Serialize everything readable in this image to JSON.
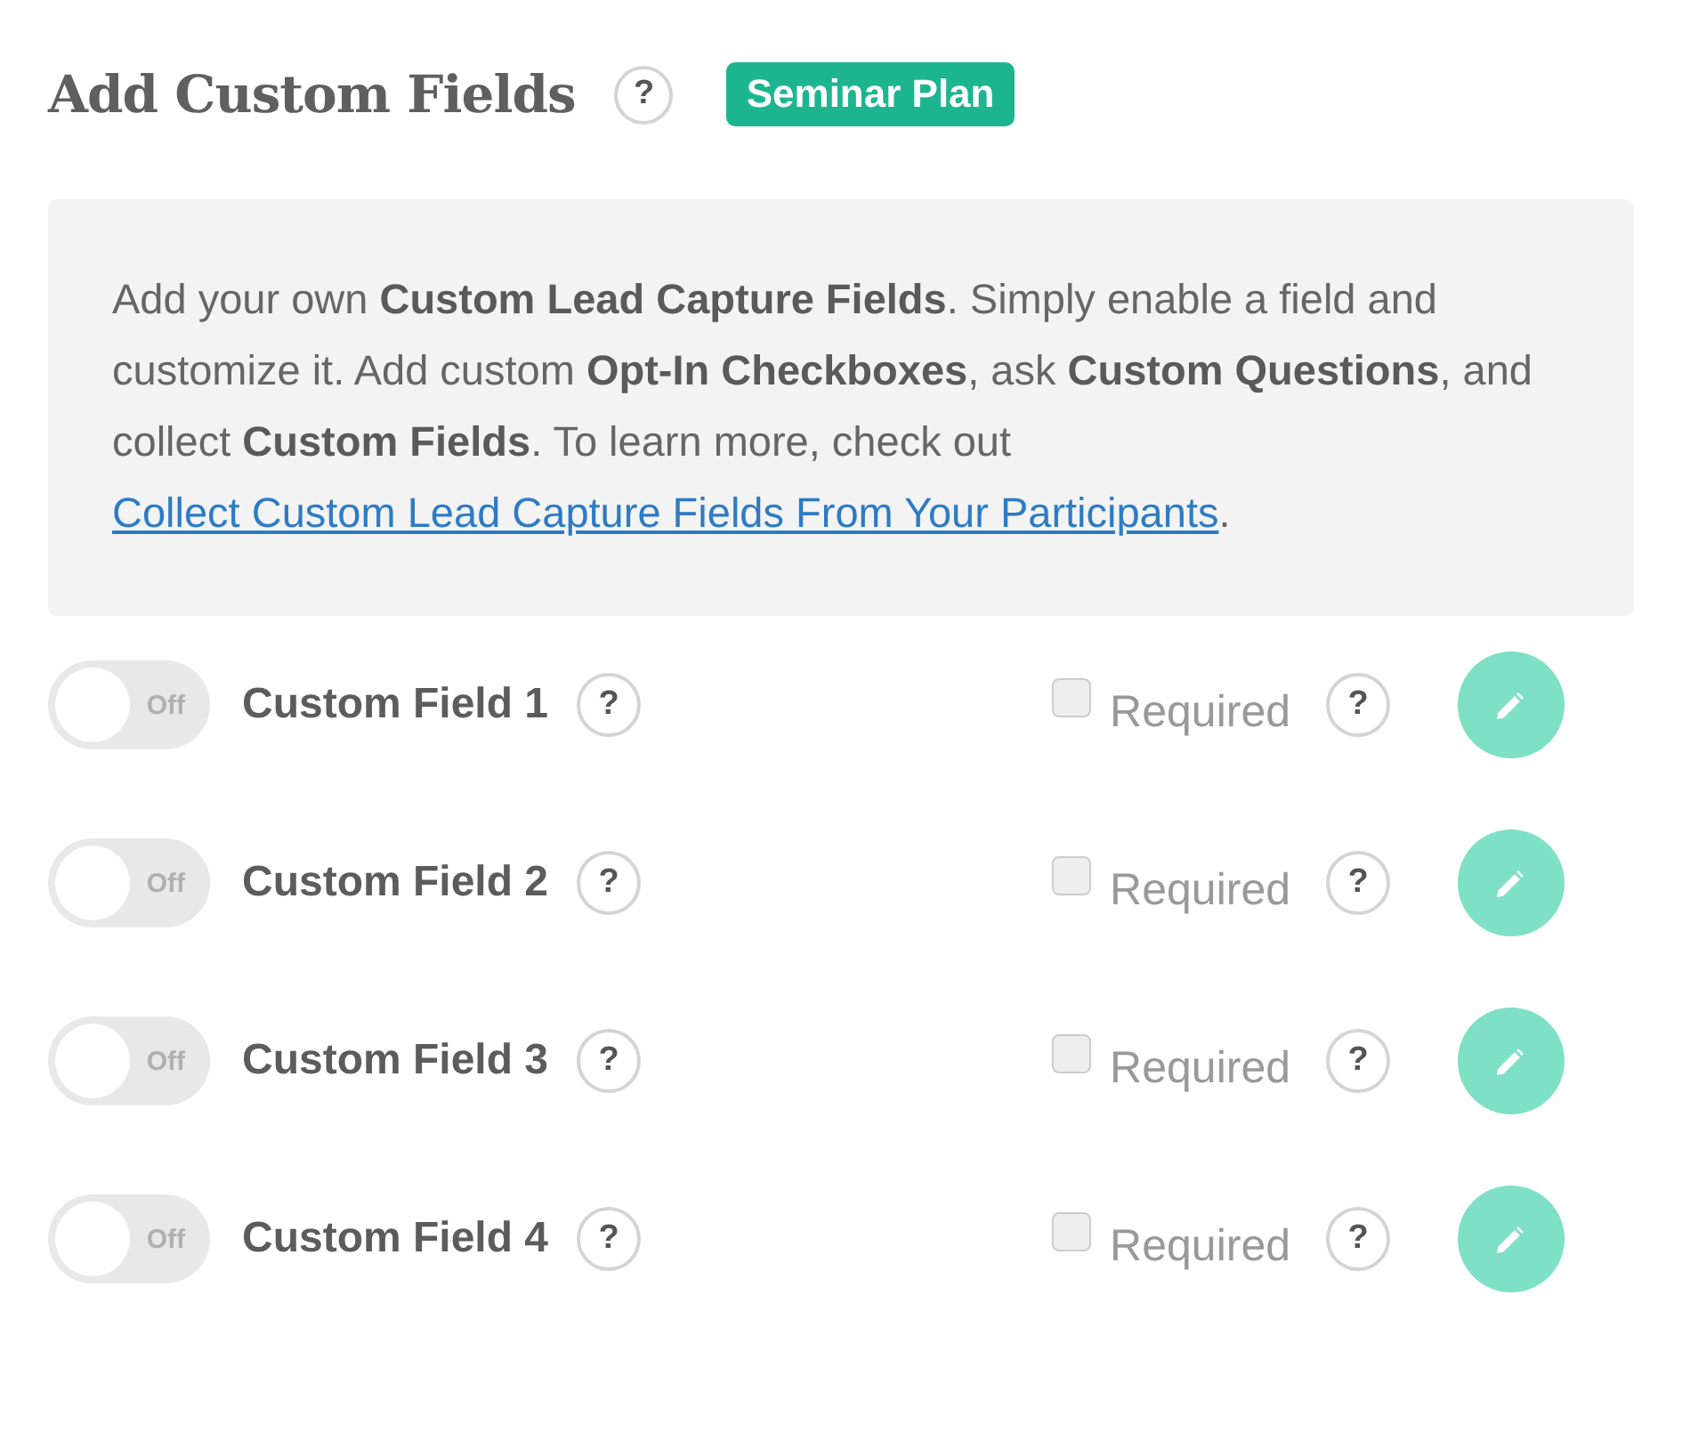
{
  "header": {
    "title": "Add Custom Fields",
    "help": "?",
    "badge": "Seminar Plan"
  },
  "info": {
    "text": "Add your own **Custom Lead Capture Fields**. Simply enable a field and customize it. Add custom **Opt-In Checkboxes**, ask **Custom Questions**, and collect **Custom Fields**. To learn more, check out ",
    "link": "Collect Custom Lead Capture Fields From Your Participants",
    "after": "."
  },
  "fields": [
    {
      "name": "Custom Field 1",
      "on": false,
      "toggle_label": "Off",
      "help": "?",
      "required_label": "Required",
      "required": false,
      "required_help": "?"
    },
    {
      "name": "Custom Field 2",
      "on": false,
      "toggle_label": "Off",
      "help": "?",
      "required_label": "Required",
      "required": false,
      "required_help": "?"
    },
    {
      "name": "Custom Field 3",
      "on": false,
      "toggle_label": "Off",
      "help": "?",
      "required_label": "Required",
      "required": false,
      "required_help": "?"
    },
    {
      "name": "Custom Field 4",
      "on": false,
      "toggle_label": "Off",
      "help": "?",
      "required_label": "Required",
      "required": false,
      "required_help": "?"
    }
  ]
}
